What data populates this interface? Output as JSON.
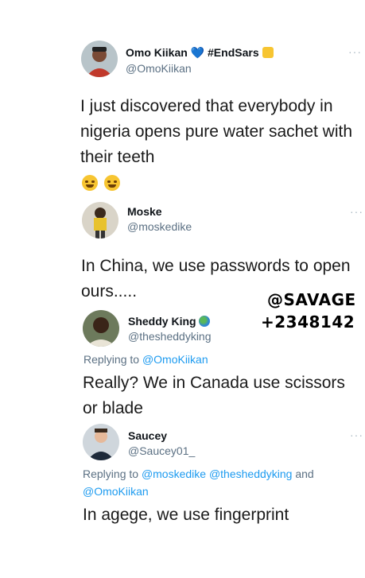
{
  "tweets": [
    {
      "name": "Omo Kiikan",
      "hashtag": "#EndSars",
      "handle": "@OmoKiikan",
      "text": "I just discovered that everybody in nigeria opens pure water sachet with their teeth",
      "emojis": [
        "face-with-tears-of-joy-icon",
        "face-with-tears-of-joy-icon"
      ]
    },
    {
      "name": "Moske",
      "handle": "@moskedike",
      "text": "In China, we use passwords to open ours....."
    },
    {
      "name": "Sheddy King",
      "handle": "@thesheddyking",
      "reply_prefix": "Replying to",
      "reply_mentions": "@OmoKiikan",
      "text": "Really? We in Canada use scissors or blade"
    },
    {
      "name": "Saucey",
      "handle": "@Saucey01_",
      "reply_prefix": "Replying to",
      "reply_mentions_a": "@moskedike @thesheddyking",
      "reply_and": "and",
      "reply_mentions_b": "@OmoKiikan",
      "text": "In agege, we use fingerprint"
    }
  ],
  "more_label": "···",
  "watermark": {
    "line1": "@SAVAGE",
    "line2": "+2348142"
  },
  "colors": {
    "mention": "#1d9bf0",
    "muted": "#5b7083",
    "heart": "#1d9bf0"
  }
}
